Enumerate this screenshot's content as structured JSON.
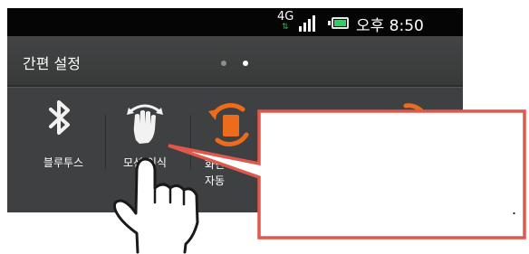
{
  "status_bar": {
    "network": "4G",
    "clock": "오후 8:50",
    "icons": [
      "signal-icon",
      "battery-icon"
    ]
  },
  "quick_settings": {
    "title": "간편 설정",
    "page_indicator": {
      "pages": 2,
      "current": 2
    },
    "tiles": [
      {
        "label": "블루투스",
        "icon": "bluetooth-icon"
      },
      {
        "label": "모션 인식",
        "icon": "hand-motion-icon"
      },
      {
        "label_line1": "화면",
        "label_line2": "자동",
        "icon": "auto-rotate-icon"
      },
      {
        "icon": "sync-icon"
      }
    ]
  },
  "callout": {
    "text": ".",
    "border_color": "#e0584b"
  },
  "colors": {
    "accent_orange": "#ec6b1d",
    "status_bar_bg": "#050505",
    "panel_bg": "#3f4041",
    "battery_green": "#3ac76b",
    "network_arrows": "#2fb34a"
  }
}
